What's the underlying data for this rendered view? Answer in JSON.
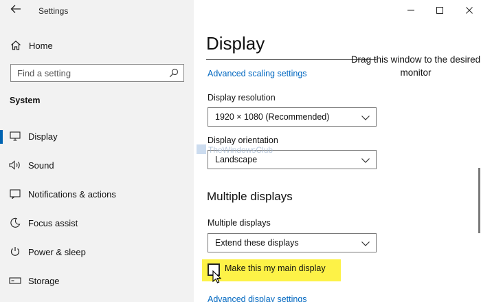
{
  "window": {
    "app_title": "Settings"
  },
  "sidebar": {
    "home_label": "Home",
    "search_placeholder": "Find a setting",
    "section_title": "System",
    "items": [
      {
        "label": "Display",
        "icon": "monitor-icon",
        "active": true
      },
      {
        "label": "Sound",
        "icon": "speaker-icon",
        "active": false
      },
      {
        "label": "Notifications & actions",
        "icon": "notification-icon",
        "active": false
      },
      {
        "label": "Focus assist",
        "icon": "moon-icon",
        "active": false
      },
      {
        "label": "Power & sleep",
        "icon": "power-icon",
        "active": false
      },
      {
        "label": "Storage",
        "icon": "storage-icon",
        "active": false
      }
    ]
  },
  "main": {
    "page_title": "Display",
    "overlay_note": "Drag this window to the desired monitor",
    "advanced_scaling_link": "Advanced scaling settings",
    "resolution": {
      "label": "Display resolution",
      "value": "1920 × 1080 (Recommended)"
    },
    "orientation": {
      "label": "Display orientation",
      "value": "Landscape"
    },
    "multiple_displays_heading": "Multiple displays",
    "multiple_displays": {
      "label": "Multiple displays",
      "value": "Extend these displays"
    },
    "main_display_checkbox": {
      "label": "Make this my main display",
      "checked": false
    },
    "advanced_display_link": "Advanced display settings",
    "watermark": "TheWindowsClub"
  },
  "colors": {
    "accent": "#0063b1",
    "link": "#0067c0",
    "highlight": "#fdf247",
    "sidebar_bg": "#f2f2f2"
  }
}
